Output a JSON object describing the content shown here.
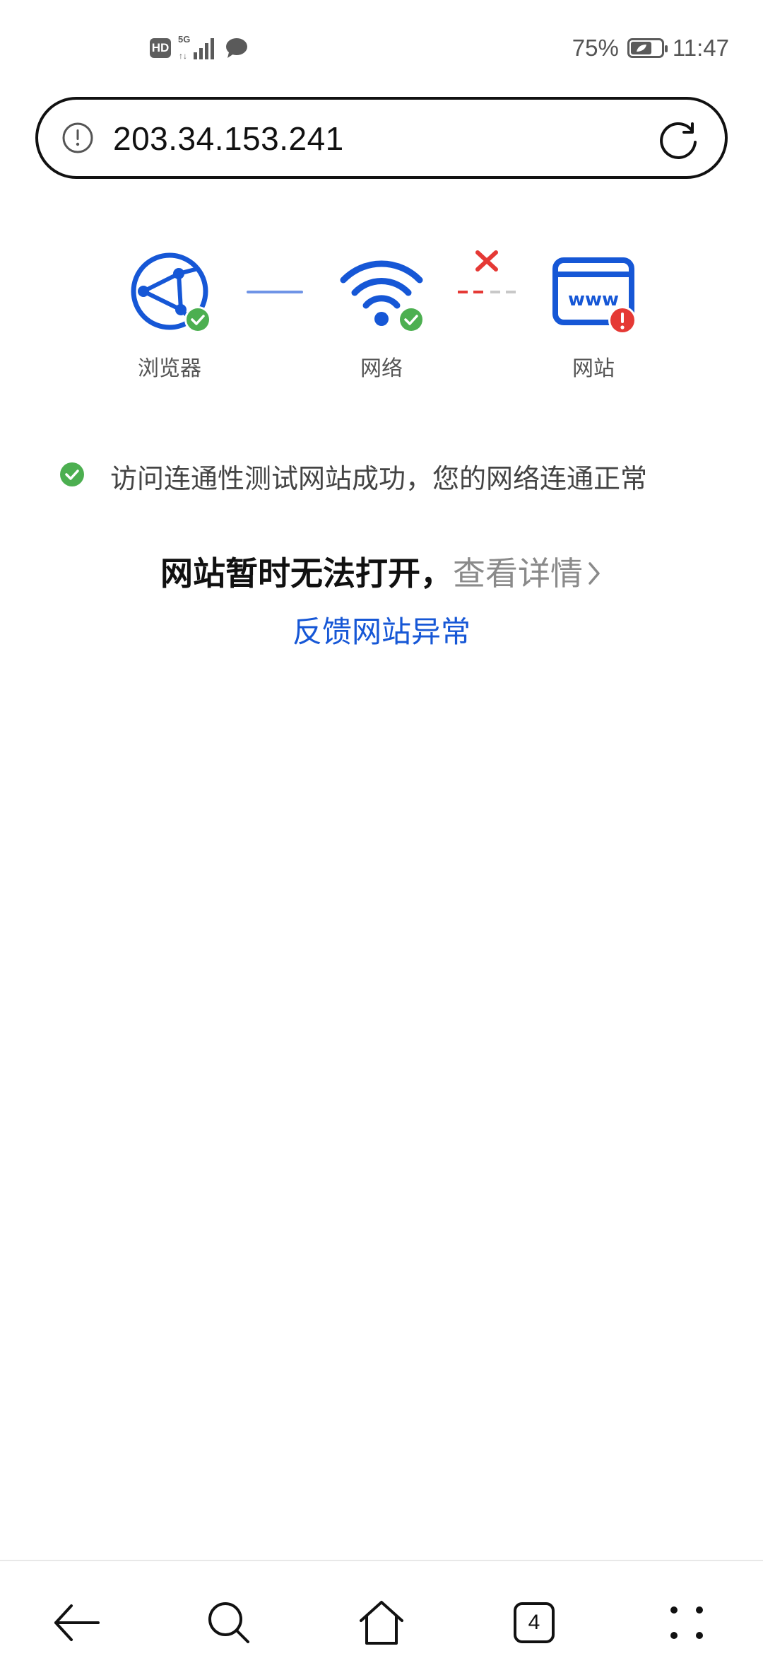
{
  "status_bar": {
    "hd": "HD",
    "network": "5G",
    "battery_percent": "75%",
    "time": "11:47",
    "icons": [
      "hd-icon",
      "signal-icon",
      "message-icon",
      "battery-icon"
    ]
  },
  "address_bar": {
    "url": "203.34.153.241",
    "left_icon": "info-icon",
    "right_icon": "refresh-icon"
  },
  "diagnostic": {
    "nodes": [
      {
        "label": "浏览器",
        "icon": "browser-globe-icon",
        "status": "ok"
      },
      {
        "label": "网络",
        "icon": "wifi-icon",
        "status": "ok"
      },
      {
        "label": "网站",
        "icon": "website-www-icon",
        "status": "error"
      }
    ],
    "links": [
      {
        "status": "ok"
      },
      {
        "status": "broken"
      }
    ]
  },
  "result": {
    "ok_message": "访问连通性测试网站成功，您的网络连通正常",
    "main_message": "网站暂时无法打开，",
    "details_link": "查看详情",
    "feedback_link": "反馈网站异常"
  },
  "bottom_nav": {
    "tab_count": "4",
    "items": [
      "back-icon",
      "search-icon",
      "home-icon",
      "tabs-icon",
      "more-icon"
    ]
  },
  "colors": {
    "accent_blue": "#1657d6",
    "ok_green": "#4caf50",
    "error_red": "#e53935"
  }
}
